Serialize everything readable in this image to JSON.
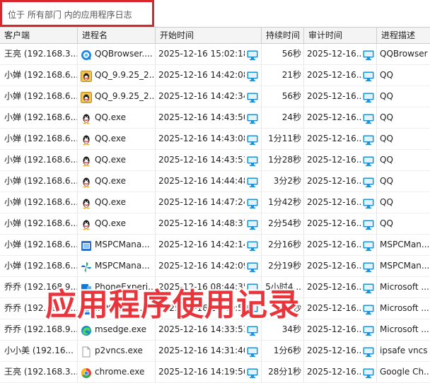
{
  "scope_text": "位于 所有部门 内的应用程序日志",
  "columns": [
    "客户端",
    "进程名",
    "开始时间",
    "持续时间",
    "审计时间",
    "进程描述"
  ],
  "rows": [
    {
      "client": "王亮 (192.168.3...",
      "process": "QQBrowser....",
      "icon": "qqbrowser-icon",
      "start": "2025-12-16 15:02:18",
      "duration": "56秒",
      "audit": "2025-12-16...",
      "desc": "QQBrowser"
    },
    {
      "client": "小婵 (192.168.6...",
      "process": "QQ_9.9.25_2...",
      "icon": "qq-installer-icon",
      "start": "2025-12-16 14:42:08",
      "duration": "21秒",
      "audit": "2025-12-16...",
      "desc": "QQ"
    },
    {
      "client": "小婵 (192.168.6...",
      "process": "QQ_9.9.25_2...",
      "icon": "qq-installer-icon",
      "start": "2025-12-16 14:42:34",
      "duration": "56秒",
      "audit": "2025-12-16...",
      "desc": "QQ"
    },
    {
      "client": "小婵 (192.168.6...",
      "process": "QQ.exe",
      "icon": "qq-penguin-icon",
      "start": "2025-12-16 14:43:50",
      "duration": "24秒",
      "audit": "2025-12-16...",
      "desc": "QQ"
    },
    {
      "client": "小婵 (192.168.6...",
      "process": "QQ.exe",
      "icon": "qq-penguin-icon",
      "start": "2025-12-16 14:43:08",
      "duration": "1分11秒",
      "audit": "2025-12-16...",
      "desc": "QQ"
    },
    {
      "client": "小婵 (192.168.6...",
      "process": "QQ.exe",
      "icon": "qq-penguin-icon",
      "start": "2025-12-16 14:43:51",
      "duration": "1分28秒",
      "audit": "2025-12-16...",
      "desc": "QQ"
    },
    {
      "client": "小婵 (192.168.6...",
      "process": "QQ.exe",
      "icon": "qq-penguin-icon",
      "start": "2025-12-16 14:44:48",
      "duration": "3分2秒",
      "audit": "2025-12-16...",
      "desc": "QQ"
    },
    {
      "client": "小婵 (192.168.6...",
      "process": "QQ.exe",
      "icon": "qq-penguin-icon",
      "start": "2025-12-16 14:47:24",
      "duration": "1分42秒",
      "audit": "2025-12-16...",
      "desc": "QQ"
    },
    {
      "client": "小婵 (192.168.6...",
      "process": "QQ.exe",
      "icon": "qq-penguin-icon",
      "start": "2025-12-16 14:48:37",
      "duration": "2分54秒",
      "audit": "2025-12-16...",
      "desc": "QQ"
    },
    {
      "client": "小婵 (192.168.6...",
      "process": "MSPCMana...",
      "icon": "mspcmanager-icon",
      "start": "2025-12-16 14:42:14",
      "duration": "2分16秒",
      "audit": "2025-12-16...",
      "desc": "MSPCMan..."
    },
    {
      "client": "小婵 (192.168.6...",
      "process": "MSPCMana...",
      "icon": "mspcmanager-pinwheel-icon",
      "start": "2025-12-16 14:42:09",
      "duration": "2分19秒",
      "audit": "2025-12-16...",
      "desc": "MSPCMan..."
    },
    {
      "client": "乔乔 (192.168.9...",
      "process": "PhoneExperi...",
      "icon": "phone-link-icon",
      "start": "2025-12-16 08:44:35",
      "duration": "5小时4...",
      "audit": "2025-12-16...",
      "desc": "Microsoft ..."
    },
    {
      "client": "乔乔 (192.168.9...",
      "process": "...PCMana...",
      "icon": "mspcmanager-icon",
      "start": "2025-12-16 14:40:58",
      "duration": "1分8秒",
      "audit": "2025-12-16...",
      "desc": "Microsoft ..."
    },
    {
      "client": "乔乔 (192.168.9...",
      "process": "msedge.exe",
      "icon": "edge-icon",
      "start": "2025-12-16 14:33:51",
      "duration": "34秒",
      "audit": "2025-12-16...",
      "desc": "Microsoft ..."
    },
    {
      "client": "小小美 (192.16...",
      "process": "p2vncs.exe",
      "icon": "blank-file-icon",
      "start": "2025-12-16 14:31:40",
      "duration": "1分6秒",
      "audit": "2025-12-16...",
      "desc": "ipsafe vncs"
    },
    {
      "client": "王亮 (192.168.3...",
      "process": "chrome.exe",
      "icon": "chrome-icon",
      "start": "2025-12-16 14:19:56",
      "duration": "28分1秒",
      "audit": "2025-12-16...",
      "desc": "Google Ch..."
    }
  ],
  "overlay_caption": "应用程序使用记录",
  "colors": {
    "highlight_border": "#d9262b",
    "caption": "#e8353c",
    "monitor_icon": "#1f8fd6"
  }
}
